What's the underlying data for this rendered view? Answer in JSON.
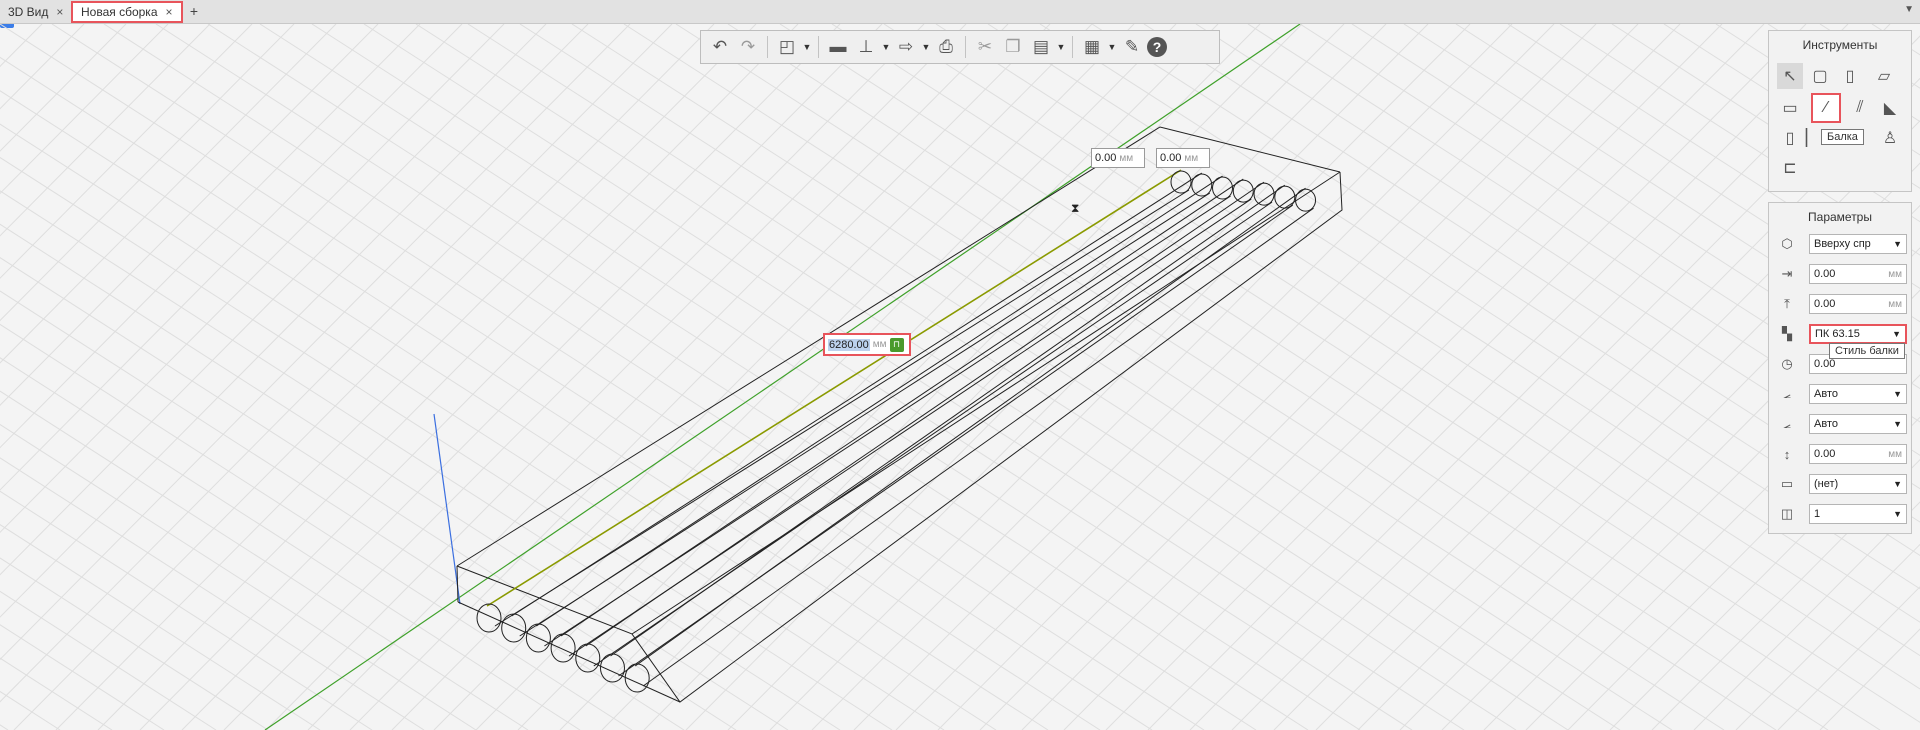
{
  "tabs": [
    {
      "label": "3D Вид",
      "active": false
    },
    {
      "label": "Новая сборка",
      "active": true
    }
  ],
  "tab_add_label": "+",
  "tab_close_glyph": "×",
  "toolbar": {
    "icons": [
      "undo-icon",
      "redo-icon",
      "view-cube-icon",
      "folder-icon",
      "stamp-icon",
      "export-icon",
      "print-icon",
      "cut-icon",
      "copy-icon",
      "paste-icon",
      "layers-icon",
      "wrench-icon",
      "help-icon"
    ],
    "help_label": "?"
  },
  "viewport": {
    "offset_x": {
      "value": "0.00",
      "unit": "мм"
    },
    "offset_y": {
      "value": "0.00",
      "unit": "мм"
    },
    "length": {
      "value": "6280.00",
      "unit": "мм"
    }
  },
  "tools_panel": {
    "title": "Инструменты",
    "tooltip": "Балка",
    "icons": [
      "select-icon",
      "wall-icon",
      "column-icon",
      "slab-icon",
      "plate-icon",
      "beam-icon",
      "multi-beam-icon",
      "roof-icon",
      "panel-icon",
      "door-icon",
      "chair-icon",
      "railing-icon"
    ]
  },
  "params_panel": {
    "title": "Параметры",
    "tooltip": "Стиль балки",
    "rows": [
      {
        "icon": "anchor-icon",
        "value": "Вверху спр",
        "type": "select"
      },
      {
        "icon": "offset-x-icon",
        "value": "0.00",
        "unit": "мм",
        "type": "input"
      },
      {
        "icon": "offset-y-icon",
        "value": "0.00",
        "unit": "мм",
        "type": "input"
      },
      {
        "icon": "beam-style-icon",
        "value": "ПК 63.15",
        "type": "select"
      },
      {
        "icon": "rotation-icon",
        "value": "0.00",
        "type": "input"
      },
      {
        "icon": "start-angle-icon",
        "value": "Авто",
        "type": "select"
      },
      {
        "icon": "end-angle-icon",
        "value": "Авто",
        "type": "select"
      },
      {
        "icon": "height-icon",
        "value": "0.00",
        "unit": "мм",
        "type": "input"
      },
      {
        "icon": "material-icon",
        "value": "(нет)",
        "type": "select"
      },
      {
        "icon": "layer-icon",
        "value": "1",
        "type": "select"
      }
    ]
  },
  "colors": {
    "accent_highlight": "#e8545b",
    "axis_x": "#3fa12a",
    "axis_z": "#3b6fe0",
    "selected_edge": "#8a9a00"
  }
}
